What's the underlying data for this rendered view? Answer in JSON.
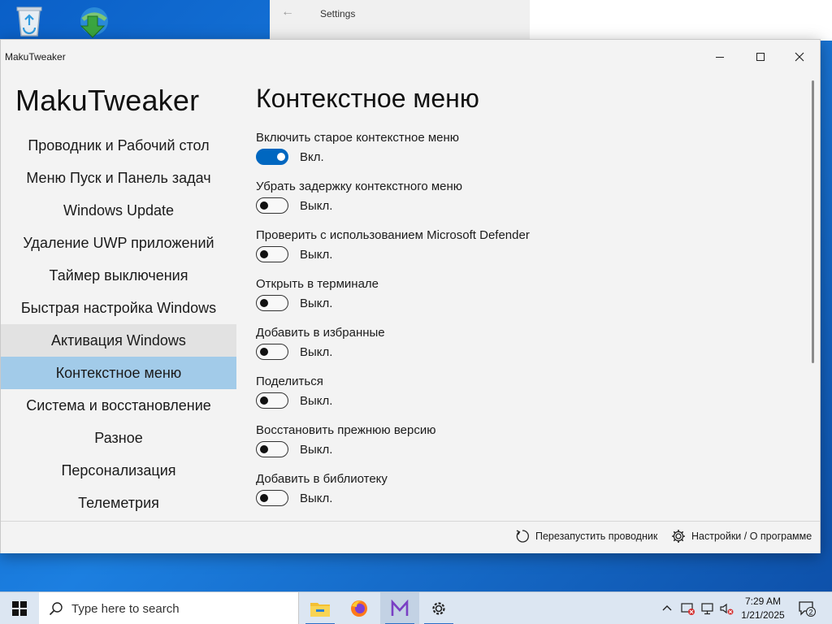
{
  "desktop": {
    "icons": [
      {
        "name": "recycle-bin-icon"
      },
      {
        "name": "internet-download-manager-icon"
      }
    ]
  },
  "background_window": {
    "title": "Settings"
  },
  "window": {
    "title": "MakuTweaker"
  },
  "sidebar": {
    "app_name": "MakuTweaker",
    "items": [
      {
        "label": "Проводник и Рабочий стол"
      },
      {
        "label": "Меню Пуск и Панель задач"
      },
      {
        "label": "Windows Update"
      },
      {
        "label": "Удаление UWP приложений"
      },
      {
        "label": "Таймер выключения"
      },
      {
        "label": "Быстрая настройка Windows"
      },
      {
        "label": "Активация Windows"
      },
      {
        "label": "Контекстное меню"
      },
      {
        "label": "Система и восстановление"
      },
      {
        "label": "Разное"
      },
      {
        "label": "Персонализация"
      },
      {
        "label": "Телеметрия"
      }
    ],
    "hovered_index": 6,
    "active_index": 7
  },
  "content": {
    "page_title": "Контекстное меню",
    "settings": [
      {
        "label": "Включить старое контекстное меню",
        "state": "Вкл.",
        "on": true
      },
      {
        "label": "Убрать задержку контекстного меню",
        "state": "Выкл.",
        "on": false
      },
      {
        "label": "Проверить с использованием Microsoft Defender",
        "state": "Выкл.",
        "on": false
      },
      {
        "label": "Открыть в терминале",
        "state": "Выкл.",
        "on": false
      },
      {
        "label": "Добавить в избранные",
        "state": "Выкл.",
        "on": false
      },
      {
        "label": "Поделиться",
        "state": "Выкл.",
        "on": false
      },
      {
        "label": "Восстановить прежнюю версию",
        "state": "Выкл.",
        "on": false
      },
      {
        "label": "Добавить в библиотеку",
        "state": "Выкл.",
        "on": false
      }
    ]
  },
  "footer": {
    "restart_label": "Перезапустить проводник",
    "settings_label": "Настройки / О программе"
  },
  "taskbar": {
    "search_placeholder": "Type here to search",
    "time": "7:29 AM",
    "date": "1/21/2025",
    "notification_count": "2"
  },
  "colors": {
    "accent": "#0067c0",
    "nav_active": "#a2cbe9",
    "nav_hover": "#e2e2e2",
    "desktop": "#1c7fe0"
  }
}
